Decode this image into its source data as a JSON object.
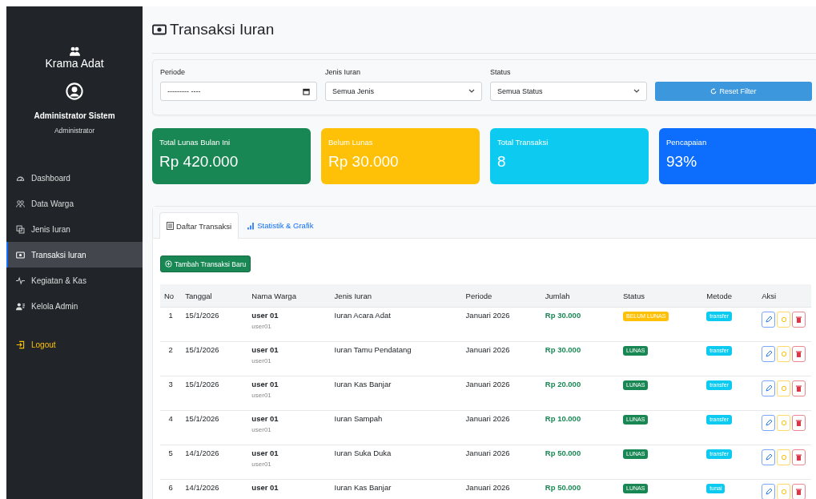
{
  "sidebar": {
    "brand": "Krama Adat",
    "user_name": "Administrator Sistem",
    "user_role": "Administrator",
    "items": [
      {
        "label": "Dashboard",
        "selected": false
      },
      {
        "label": "Data Warga",
        "selected": false
      },
      {
        "label": "Jenis Iuran",
        "selected": false
      },
      {
        "label": "Transaksi Iuran",
        "selected": true
      },
      {
        "label": "Kegiatan & Kas",
        "selected": false
      },
      {
        "label": "Kelola Admin",
        "selected": false
      }
    ],
    "logout": "Logout"
  },
  "page_title": "Transaksi Iuran",
  "filters": {
    "periode_label": "Periode",
    "periode_value": "--------- ----",
    "jenis_label": "Jenis Iuran",
    "jenis_value": "Semua Jenis",
    "status_label": "Status",
    "status_value": "Semua Status",
    "reset_button": "Reset Filter"
  },
  "stats": [
    {
      "label": "Total Lunas Bulan Ini",
      "value": "Rp 420.000",
      "color": "#198754"
    },
    {
      "label": "Belum Lunas",
      "value": "Rp 30.000",
      "color": "#ffc107"
    },
    {
      "label": "Total Transaksi",
      "value": "8",
      "color": "#0dcaf0"
    },
    {
      "label": "Pencapaian",
      "value": "93%",
      "color": "#0d6efd"
    }
  ],
  "tabs": [
    {
      "label": "Daftar Transaksi",
      "selected": true
    },
    {
      "label": "Statistik & Grafik",
      "selected": false
    }
  ],
  "add_button": "Tambah Transaksi Baru",
  "table": {
    "columns": [
      "No",
      "Tanggal",
      "Nama Warga",
      "Jenis Iuran",
      "Periode",
      "Jumlah",
      "Status",
      "Metode",
      "Aksi"
    ],
    "rows": [
      {
        "no": "1",
        "tanggal": "15/1/2026",
        "nama": "user 01",
        "username": "user01",
        "jenis": "Iuran Acara Adat",
        "periode": "Januari 2026",
        "jumlah": "Rp 30.000",
        "status": "BELUM LUNAS",
        "paid": false,
        "metode": "transfer"
      },
      {
        "no": "2",
        "tanggal": "15/1/2026",
        "nama": "user 01",
        "username": "user01",
        "jenis": "Iuran Tamu Pendatang",
        "periode": "Januari 2026",
        "jumlah": "Rp 30.000",
        "status": "LUNAS",
        "paid": true,
        "metode": "transfer"
      },
      {
        "no": "3",
        "tanggal": "15/1/2026",
        "nama": "user 01",
        "username": "user01",
        "jenis": "Iuran Kas Banjar",
        "periode": "Januari 2026",
        "jumlah": "Rp 20.000",
        "status": "LUNAS",
        "paid": true,
        "metode": "transfer"
      },
      {
        "no": "4",
        "tanggal": "15/1/2026",
        "nama": "user 01",
        "username": "user01",
        "jenis": "Iuran Sampah",
        "periode": "Januari 2026",
        "jumlah": "Rp 10.000",
        "status": "LUNAS",
        "paid": true,
        "metode": "transfer"
      },
      {
        "no": "5",
        "tanggal": "14/1/2026",
        "nama": "user 01",
        "username": "user01",
        "jenis": "Iuran Suka Duka",
        "periode": "Januari 2026",
        "jumlah": "Rp 50.000",
        "status": "LUNAS",
        "paid": true,
        "metode": "transfer"
      },
      {
        "no": "6",
        "tanggal": "14/1/2026",
        "nama": "user 01",
        "jenis": "Iuran Kas Banjar",
        "periode": "Januari 2026",
        "jumlah": "Rp 50.000",
        "status": "LUNAS",
        "paid": true,
        "metode": "tunai"
      }
    ]
  }
}
